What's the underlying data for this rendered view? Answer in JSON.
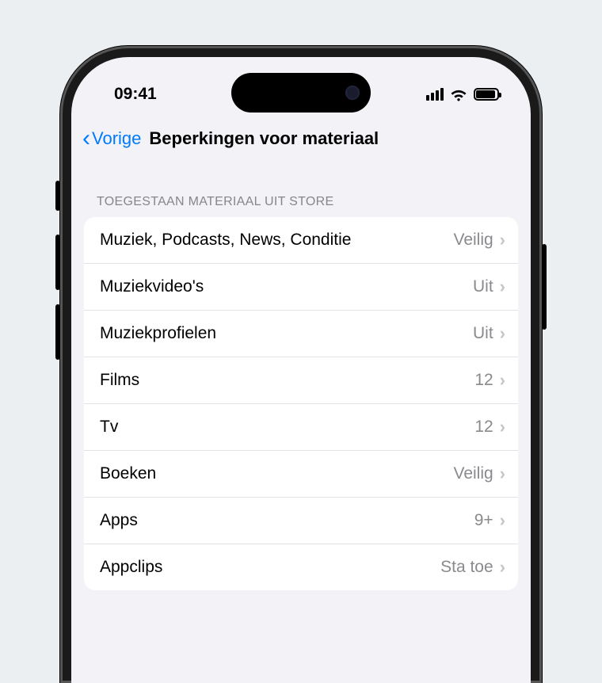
{
  "status": {
    "time": "09:41"
  },
  "nav": {
    "back": "Vorige",
    "title": "Beperkingen voor materiaal"
  },
  "section": {
    "header": "TOEGESTAAN MATERIAAL UIT STORE"
  },
  "rows": [
    {
      "label": "Muziek, Podcasts, News, Conditie",
      "value": "Veilig"
    },
    {
      "label": "Muziekvideo's",
      "value": "Uit"
    },
    {
      "label": "Muziekprofielen",
      "value": "Uit"
    },
    {
      "label": "Films",
      "value": "12"
    },
    {
      "label": "Tv",
      "value": "12"
    },
    {
      "label": "Boeken",
      "value": "Veilig"
    },
    {
      "label": "Apps",
      "value": "9+"
    },
    {
      "label": "Appclips",
      "value": "Sta toe"
    }
  ]
}
